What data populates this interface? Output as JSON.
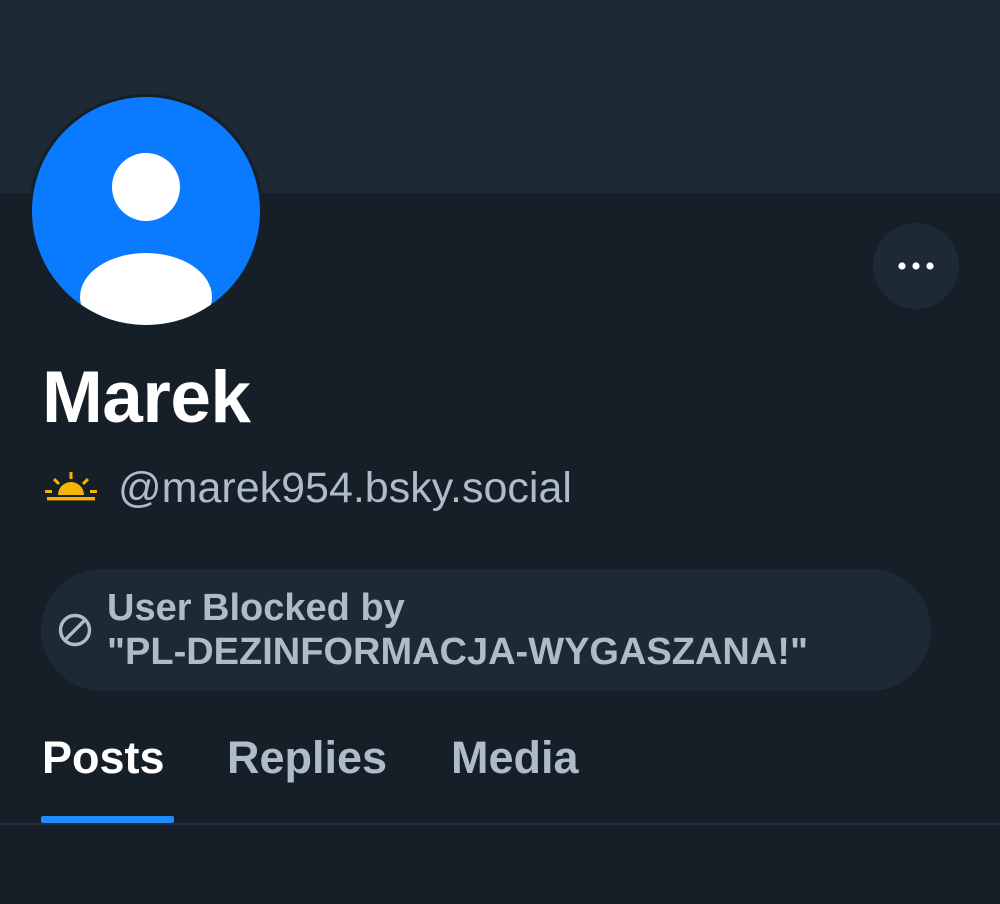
{
  "profile": {
    "display_name": "Marek",
    "handle": "@marek954.bsky.social",
    "avatar_icon": "default-user-avatar-icon",
    "handle_icon": "sunrise-icon"
  },
  "actions": {
    "more_icon": "ellipsis-icon"
  },
  "blocked_notice": {
    "icon": "no-entry-icon",
    "line1": "User Blocked by",
    "line2": "\"PL-DEZINFORMACJA-WYGASZANA!\""
  },
  "tabs": [
    {
      "label": "Posts",
      "active": true
    },
    {
      "label": "Replies",
      "active": false
    },
    {
      "label": "Media",
      "active": false
    }
  ],
  "colors": {
    "background": "#161e27",
    "banner": "#1e2936",
    "avatar": "#0a7aff",
    "accent": "#208bfe",
    "muted_text": "#aebbc9",
    "sun": "#f5b400"
  }
}
